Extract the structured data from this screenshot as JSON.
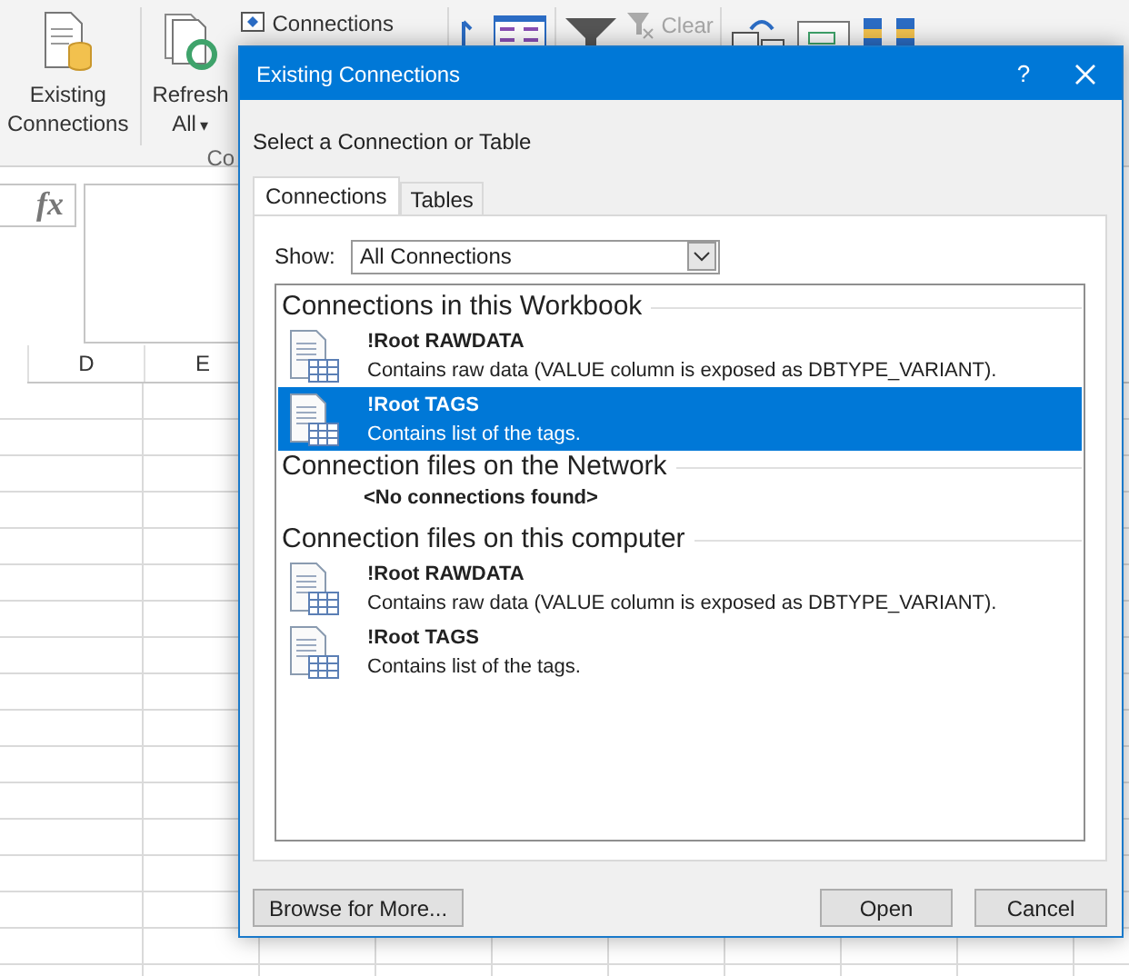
{
  "ribbon": {
    "existing_connections": {
      "lines": [
        "Existing",
        "Connections"
      ]
    },
    "refresh_all": {
      "lines": [
        "Refresh",
        "All"
      ],
      "caret": "▾"
    },
    "connections": {
      "label": "Connections"
    },
    "clear": {
      "label": "Clear",
      "disabled": true
    },
    "group_label": "Co"
  },
  "formula_bar": {
    "fx": "fx"
  },
  "sheet": {
    "columns": [
      "D",
      "E"
    ]
  },
  "dialog": {
    "title": "Existing Connections",
    "help": "?",
    "prompt": "Select a Connection or Table",
    "tabs": [
      {
        "label": "Connections",
        "selected": true
      },
      {
        "label": "Tables",
        "selected": false
      }
    ],
    "show": {
      "label": "Show:",
      "value": "All Connections"
    },
    "groups": [
      {
        "heading": "Connections in this Workbook",
        "items": [
          {
            "name": "!Root RAWDATA",
            "description": "Contains raw data (VALUE column is exposed as DBTYPE_VARIANT).",
            "selected": false
          },
          {
            "name": "!Root TAGS",
            "description": "Contains list of the tags.",
            "selected": true
          }
        ]
      },
      {
        "heading": "Connection files on the Network",
        "empty": "<No connections found>"
      },
      {
        "heading": "Connection files on this computer",
        "items": [
          {
            "name": "!Root RAWDATA",
            "description": "Contains raw data (VALUE column is exposed as DBTYPE_VARIANT).",
            "selected": false
          },
          {
            "name": "!Root TAGS",
            "description": "Contains list of the tags.",
            "selected": false
          }
        ]
      }
    ],
    "buttons": {
      "browse": "Browse for More...",
      "open": "Open",
      "cancel": "Cancel"
    }
  }
}
